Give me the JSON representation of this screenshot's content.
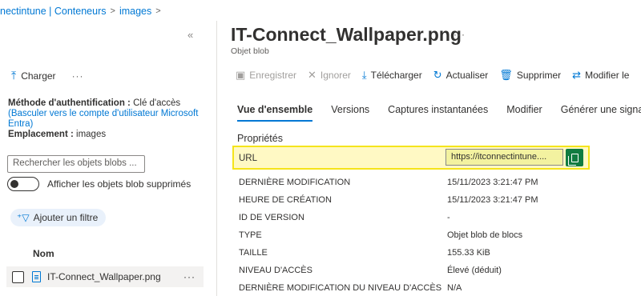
{
  "breadcrumb": {
    "items": [
      "nectintune | Conteneurs",
      "images"
    ],
    "sep": ">"
  },
  "left": {
    "collapse_glyph": "«",
    "upload_label": "Charger",
    "more_glyph": "···",
    "auth_label": "Méthode d'authentification :",
    "auth_value": "Clé d'accès",
    "auth_link": "(Basculer vers le compte d'utilisateur Microsoft Entra)",
    "location_label": "Emplacement :",
    "location_value": "images",
    "search_placeholder": "Rechercher les objets blobs ...",
    "toggle_label": "Afficher les objets blob supprimés",
    "filter_label": "Ajouter un filtre",
    "column_name": "Nom",
    "blob_name": "IT-Connect_Wallpaper.png",
    "row_more": "···"
  },
  "header": {
    "title": "IT-Connect_Wallpaper.png",
    "more_glyph": "···",
    "subtitle": "Objet blob"
  },
  "toolbar": {
    "save": "Enregistrer",
    "ignore": "Ignorer",
    "download": "Télécharger",
    "refresh": "Actualiser",
    "delete": "Supprimer",
    "modify": "Modifier le"
  },
  "tabs": [
    "Vue d'ensemble",
    "Versions",
    "Captures instantanées",
    "Modifier",
    "Générer une signatu"
  ],
  "properties": {
    "section_title": "Propriétés",
    "url_label": "URL",
    "url_value": "https://itconnectintune....",
    "rows": [
      {
        "key": "DERNIÈRE MODIFICATION",
        "value": "15/11/2023 3:21:47 PM"
      },
      {
        "key": "HEURE DE CRÉATION",
        "value": "15/11/2023 3:21:47 PM"
      },
      {
        "key": "ID DE VERSION",
        "value": "-"
      },
      {
        "key": "TYPE",
        "value": "Objet blob de blocs"
      },
      {
        "key": "TAILLE",
        "value": "155.33 KiB"
      },
      {
        "key": "NIVEAU D'ACCÈS",
        "value": "Élevé (déduit)"
      },
      {
        "key": "DERNIÈRE MODIFICATION DU NIVEAU D'ACCÈS",
        "value": "N/A"
      }
    ]
  },
  "colors": {
    "accent": "#0078d4",
    "highlight": "#fff9c4",
    "copy_button": "#107c41"
  },
  "icons": {
    "upload": "upload-icon",
    "save": "save-icon",
    "ignore": "close-icon",
    "download": "download-icon",
    "refresh": "refresh-icon",
    "delete": "delete-icon",
    "modify": "swap-icon",
    "filter": "filter-add-icon",
    "file": "file-icon",
    "copy": "copy-icon"
  }
}
